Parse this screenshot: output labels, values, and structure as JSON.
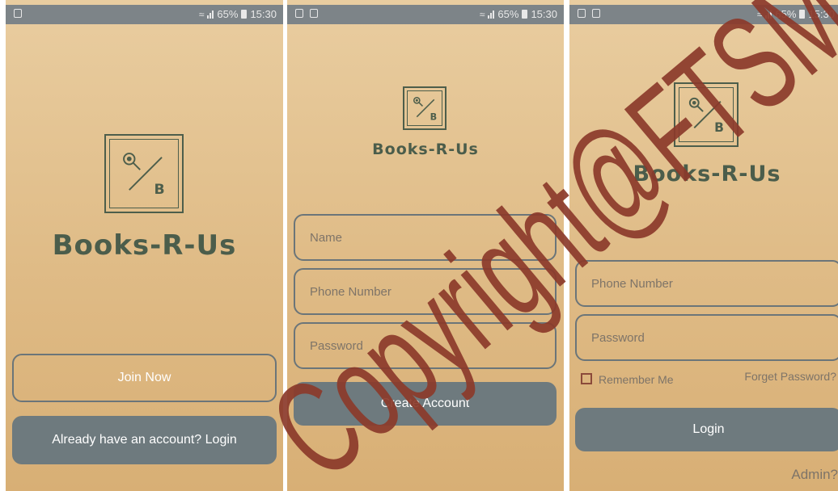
{
  "statusbar": {
    "battery_text": "65%",
    "time": "15:30"
  },
  "screen1": {
    "brand": "Books-R-Us",
    "join_label": "Join Now",
    "login_label": "Already have an account? Login"
  },
  "screen2": {
    "brand": "Books-R-Us",
    "name_placeholder": "Name",
    "phone_placeholder": "Phone Number",
    "password_placeholder": "Password",
    "create_label": "Create Account"
  },
  "screen3": {
    "brand": "Books-R-Us",
    "phone_placeholder": "Phone Number",
    "password_placeholder": "Password",
    "remember_label": "Remember Me",
    "forget_label": "Forget Password?",
    "login_label": "Login",
    "admin_label": "Admin?"
  },
  "logo_letter": "B",
  "watermark_text": "Copyright@FTSM",
  "colors": {
    "background_top": "#e9cda0",
    "background_bottom": "#d8af75",
    "brand": "#4b5d4b",
    "button_filled": "#6e7a7e",
    "outline": "#6b7579",
    "watermark": "#8b3a2a"
  }
}
